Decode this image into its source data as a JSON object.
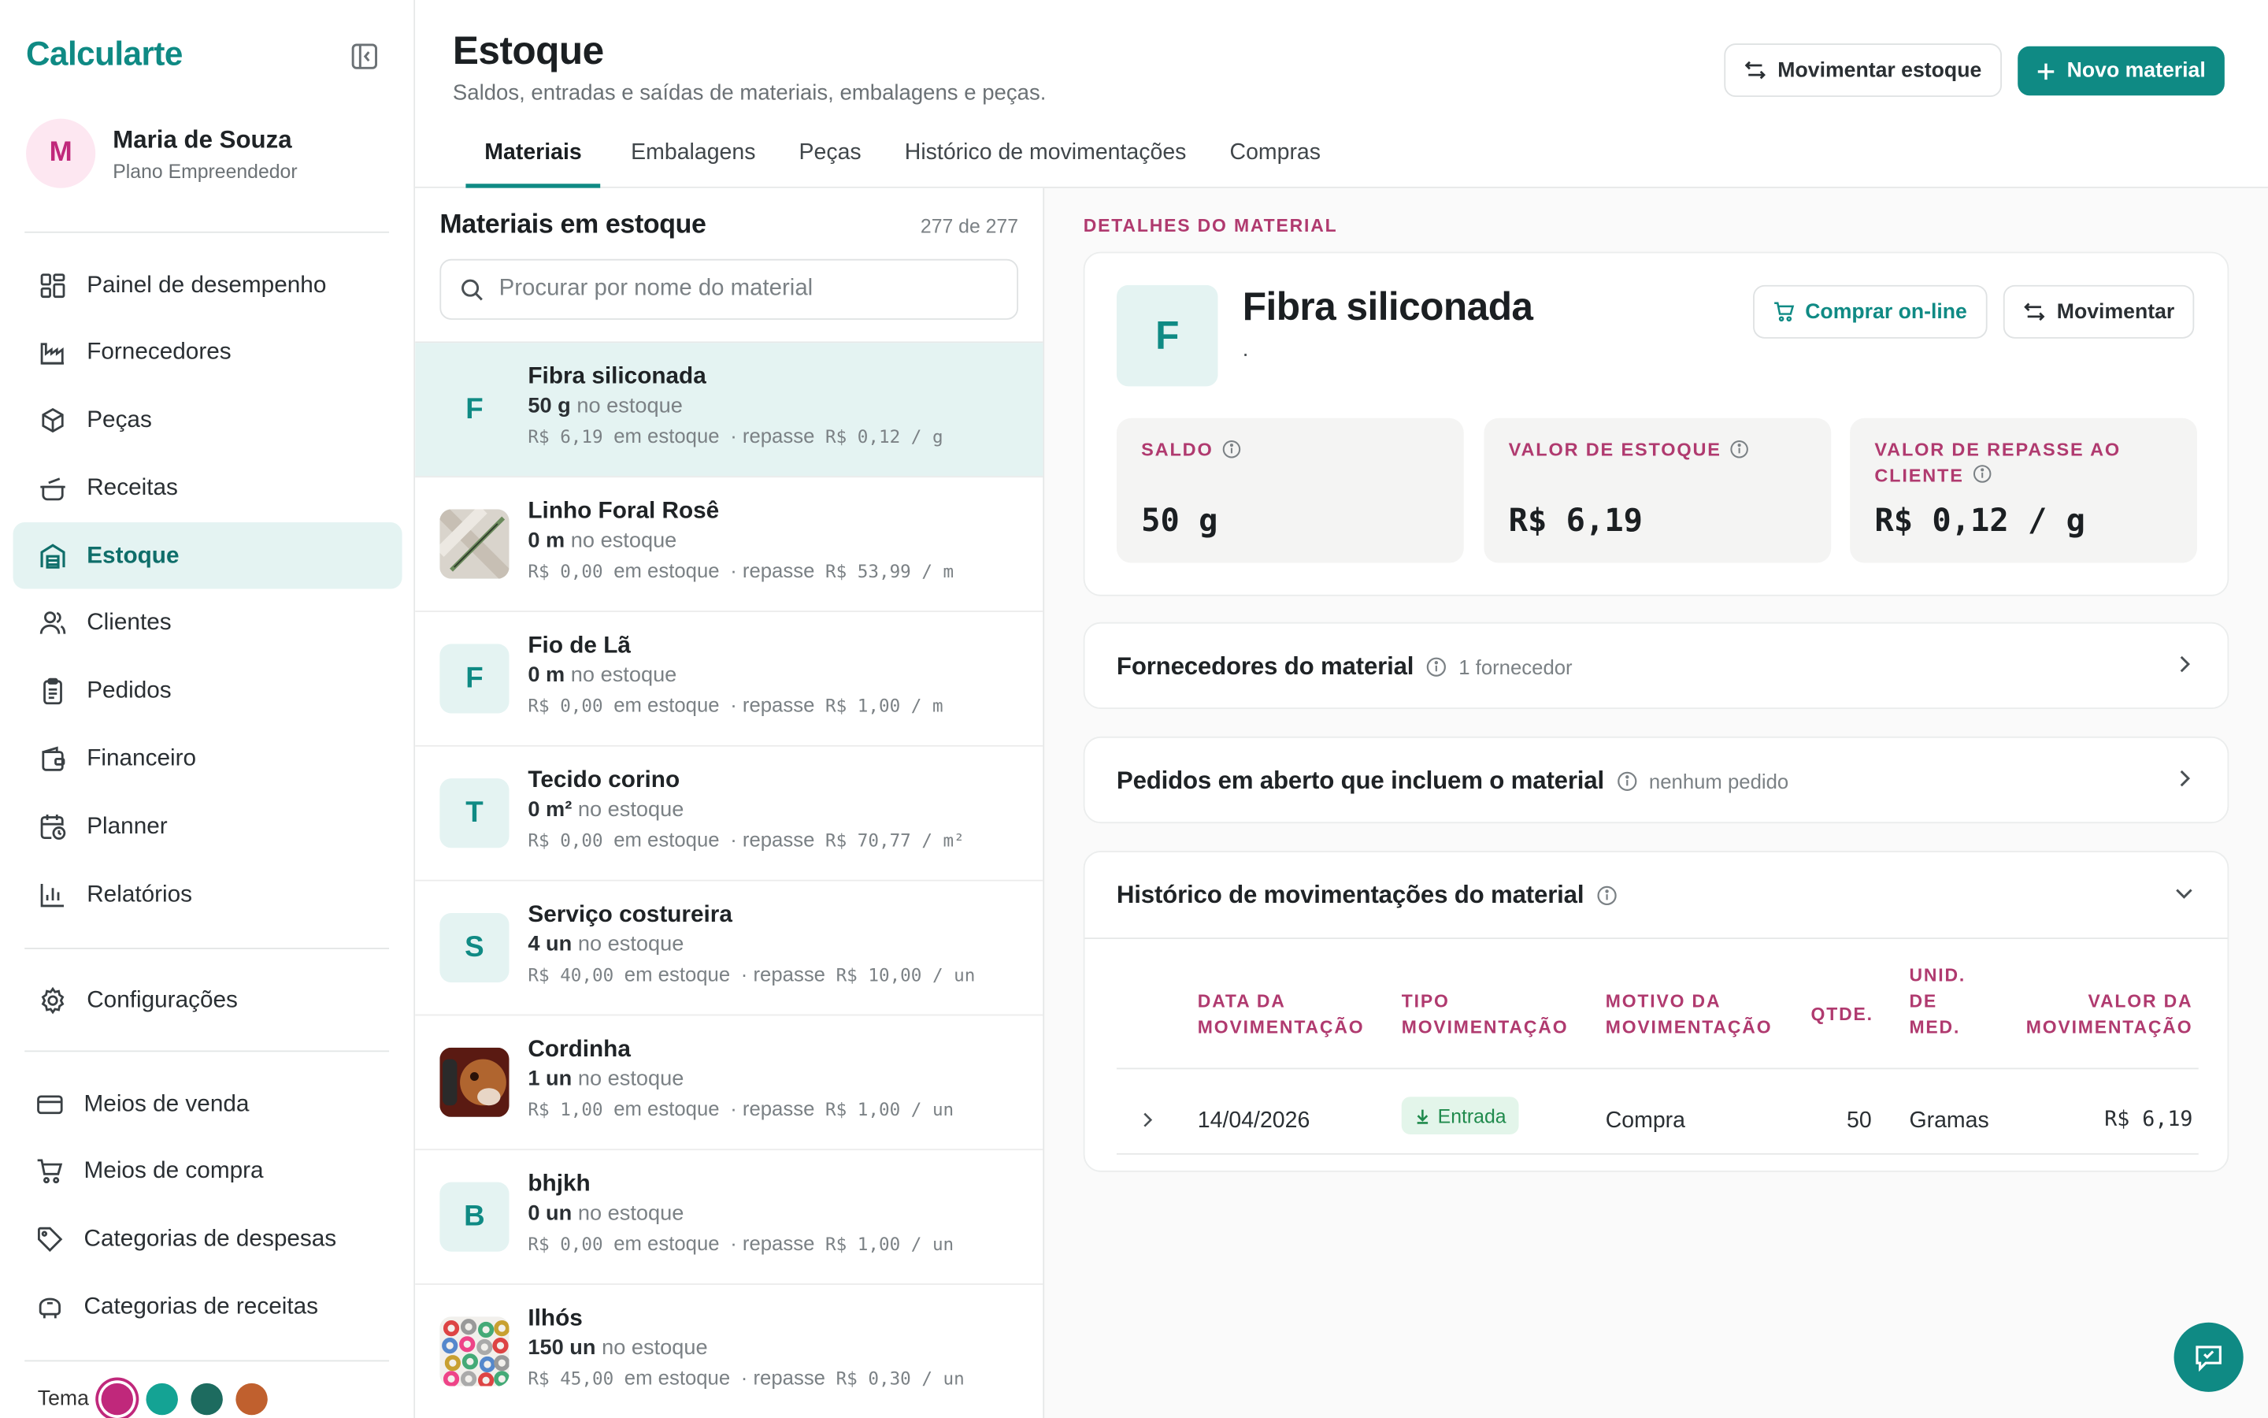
{
  "brand": "Calcularte",
  "user": {
    "initial": "M",
    "name": "Maria de Souza",
    "plan": "Plano Empreendedor"
  },
  "nav": [
    {
      "label": "Painel de desempenho",
      "icon": "dashboard-icon"
    },
    {
      "label": "Fornecedores",
      "icon": "factory-icon"
    },
    {
      "label": "Peças",
      "icon": "box-icon"
    },
    {
      "label": "Receitas",
      "icon": "cooking-pot-icon"
    },
    {
      "label": "Estoque",
      "icon": "warehouse-icon",
      "active": true
    },
    {
      "label": "Clientes",
      "icon": "users-icon"
    },
    {
      "label": "Pedidos",
      "icon": "clipboard-icon"
    },
    {
      "label": "Financeiro",
      "icon": "wallet-icon"
    },
    {
      "label": "Planner",
      "icon": "calendar-clock-icon"
    },
    {
      "label": "Relatórios",
      "icon": "bar-chart-icon"
    }
  ],
  "nav_config": {
    "label": "Configurações",
    "icon": "gear-icon"
  },
  "nav_bottom": [
    {
      "label": "Meios de venda",
      "icon": "credit-card-icon"
    },
    {
      "label": "Meios de compra",
      "icon": "shopping-cart-icon"
    },
    {
      "label": "Categorias de despesas",
      "icon": "tag-icon"
    },
    {
      "label": "Categorias de receitas",
      "icon": "piggy-bank-icon"
    }
  ],
  "theme": {
    "label": "Tema",
    "colors": [
      "#c0287b",
      "#14a394",
      "#1d6b5f",
      "#c0602e"
    ]
  },
  "page": {
    "title": "Estoque",
    "subtitle": "Saldos, entradas e saídas de materiais, embalagens e peças.",
    "move_button": "Movimentar estoque",
    "new_button": "Novo material"
  },
  "tabs": [
    "Materiais",
    "Embalagens",
    "Peças",
    "Histórico de movimentações",
    "Compras"
  ],
  "list": {
    "title": "Materiais em estoque",
    "count": "277 de 277",
    "search_placeholder": "Procurar por nome do material",
    "items": [
      {
        "initial": "F",
        "name": "Fibra siliconada",
        "qty": "50 g",
        "qty_suffix": "no estoque",
        "value": "R$ 6,19",
        "em": "em estoque",
        "sep": "· repasse",
        "repasse": "R$ 0,12 / g"
      },
      {
        "initial": "",
        "name": "Linho Foral Rosê",
        "qty": "0 m",
        "qty_suffix": "no estoque",
        "value": "R$ 0,00",
        "em": "em estoque",
        "sep": "· repasse",
        "repasse": "R$ 53,99 / m"
      },
      {
        "initial": "F",
        "name": "Fio de Lã",
        "qty": "0 m",
        "qty_suffix": "no estoque",
        "value": "R$ 0,00",
        "em": "em estoque",
        "sep": "· repasse",
        "repasse": "R$ 1,00 / m"
      },
      {
        "initial": "T",
        "name": "Tecido corino",
        "qty": "0 m²",
        "qty_suffix": "no estoque",
        "value": "R$ 0,00",
        "em": "em estoque",
        "sep": "· repasse",
        "repasse": "R$ 70,77 / m²"
      },
      {
        "initial": "S",
        "name": "Serviço costureira",
        "qty": "4 un",
        "qty_suffix": "no estoque",
        "value": "R$ 40,00",
        "em": "em estoque",
        "sep": "· repasse",
        "repasse": "R$ 10,00 / un"
      },
      {
        "initial": "",
        "name": "Cordinha",
        "qty": "1 un",
        "qty_suffix": "no estoque",
        "value": "R$ 1,00",
        "em": "em estoque",
        "sep": "· repasse",
        "repasse": "R$ 1,00 / un"
      },
      {
        "initial": "B",
        "name": "bhjkh",
        "qty": "0 un",
        "qty_suffix": "no estoque",
        "value": "R$ 0,00",
        "em": "em estoque",
        "sep": "· repasse",
        "repasse": "R$ 1,00 / un"
      },
      {
        "initial": "",
        "name": "Ilhós",
        "qty": "150 un",
        "qty_suffix": "no estoque",
        "value": "R$ 45,00",
        "em": "em estoque",
        "sep": "· repasse",
        "repasse": "R$ 0,30 / un"
      }
    ]
  },
  "detail": {
    "section_label": "DETALHES DO MATERIAL",
    "initial": "F",
    "name": "Fibra siliconada",
    "description": ".",
    "buy_button": "Comprar on-line",
    "move_button": "Movimentar",
    "stats": [
      {
        "label": "SALDO",
        "value": "50 g"
      },
      {
        "label": "VALOR DE ESTOQUE",
        "value": "R$ 6,19"
      },
      {
        "label": "VALOR DE REPASSE AO CLIENTE",
        "value": "R$ 0,12 / g"
      }
    ],
    "suppliers": {
      "title": "Fornecedores do material",
      "meta": "1 fornecedor"
    },
    "orders": {
      "title": "Pedidos em aberto que incluem o material",
      "meta": "nenhum pedido"
    },
    "history": {
      "title": "Histórico de movimentações do material",
      "headers": [
        "DATA DA MOVIMENTAÇÃO",
        "TIPO MOVIMENTAÇÃO",
        "MOTIVO DA MOVIMENTAÇÃO",
        "QTDE.",
        "UNID. DE MED.",
        "VALOR DA MOVIMENTAÇÃO"
      ],
      "rows": [
        {
          "date": "14/04/2026",
          "type": "Entrada",
          "reason": "Compra",
          "qty": "50",
          "unit": "Gramas",
          "value": "R$ 6,19"
        }
      ]
    }
  }
}
